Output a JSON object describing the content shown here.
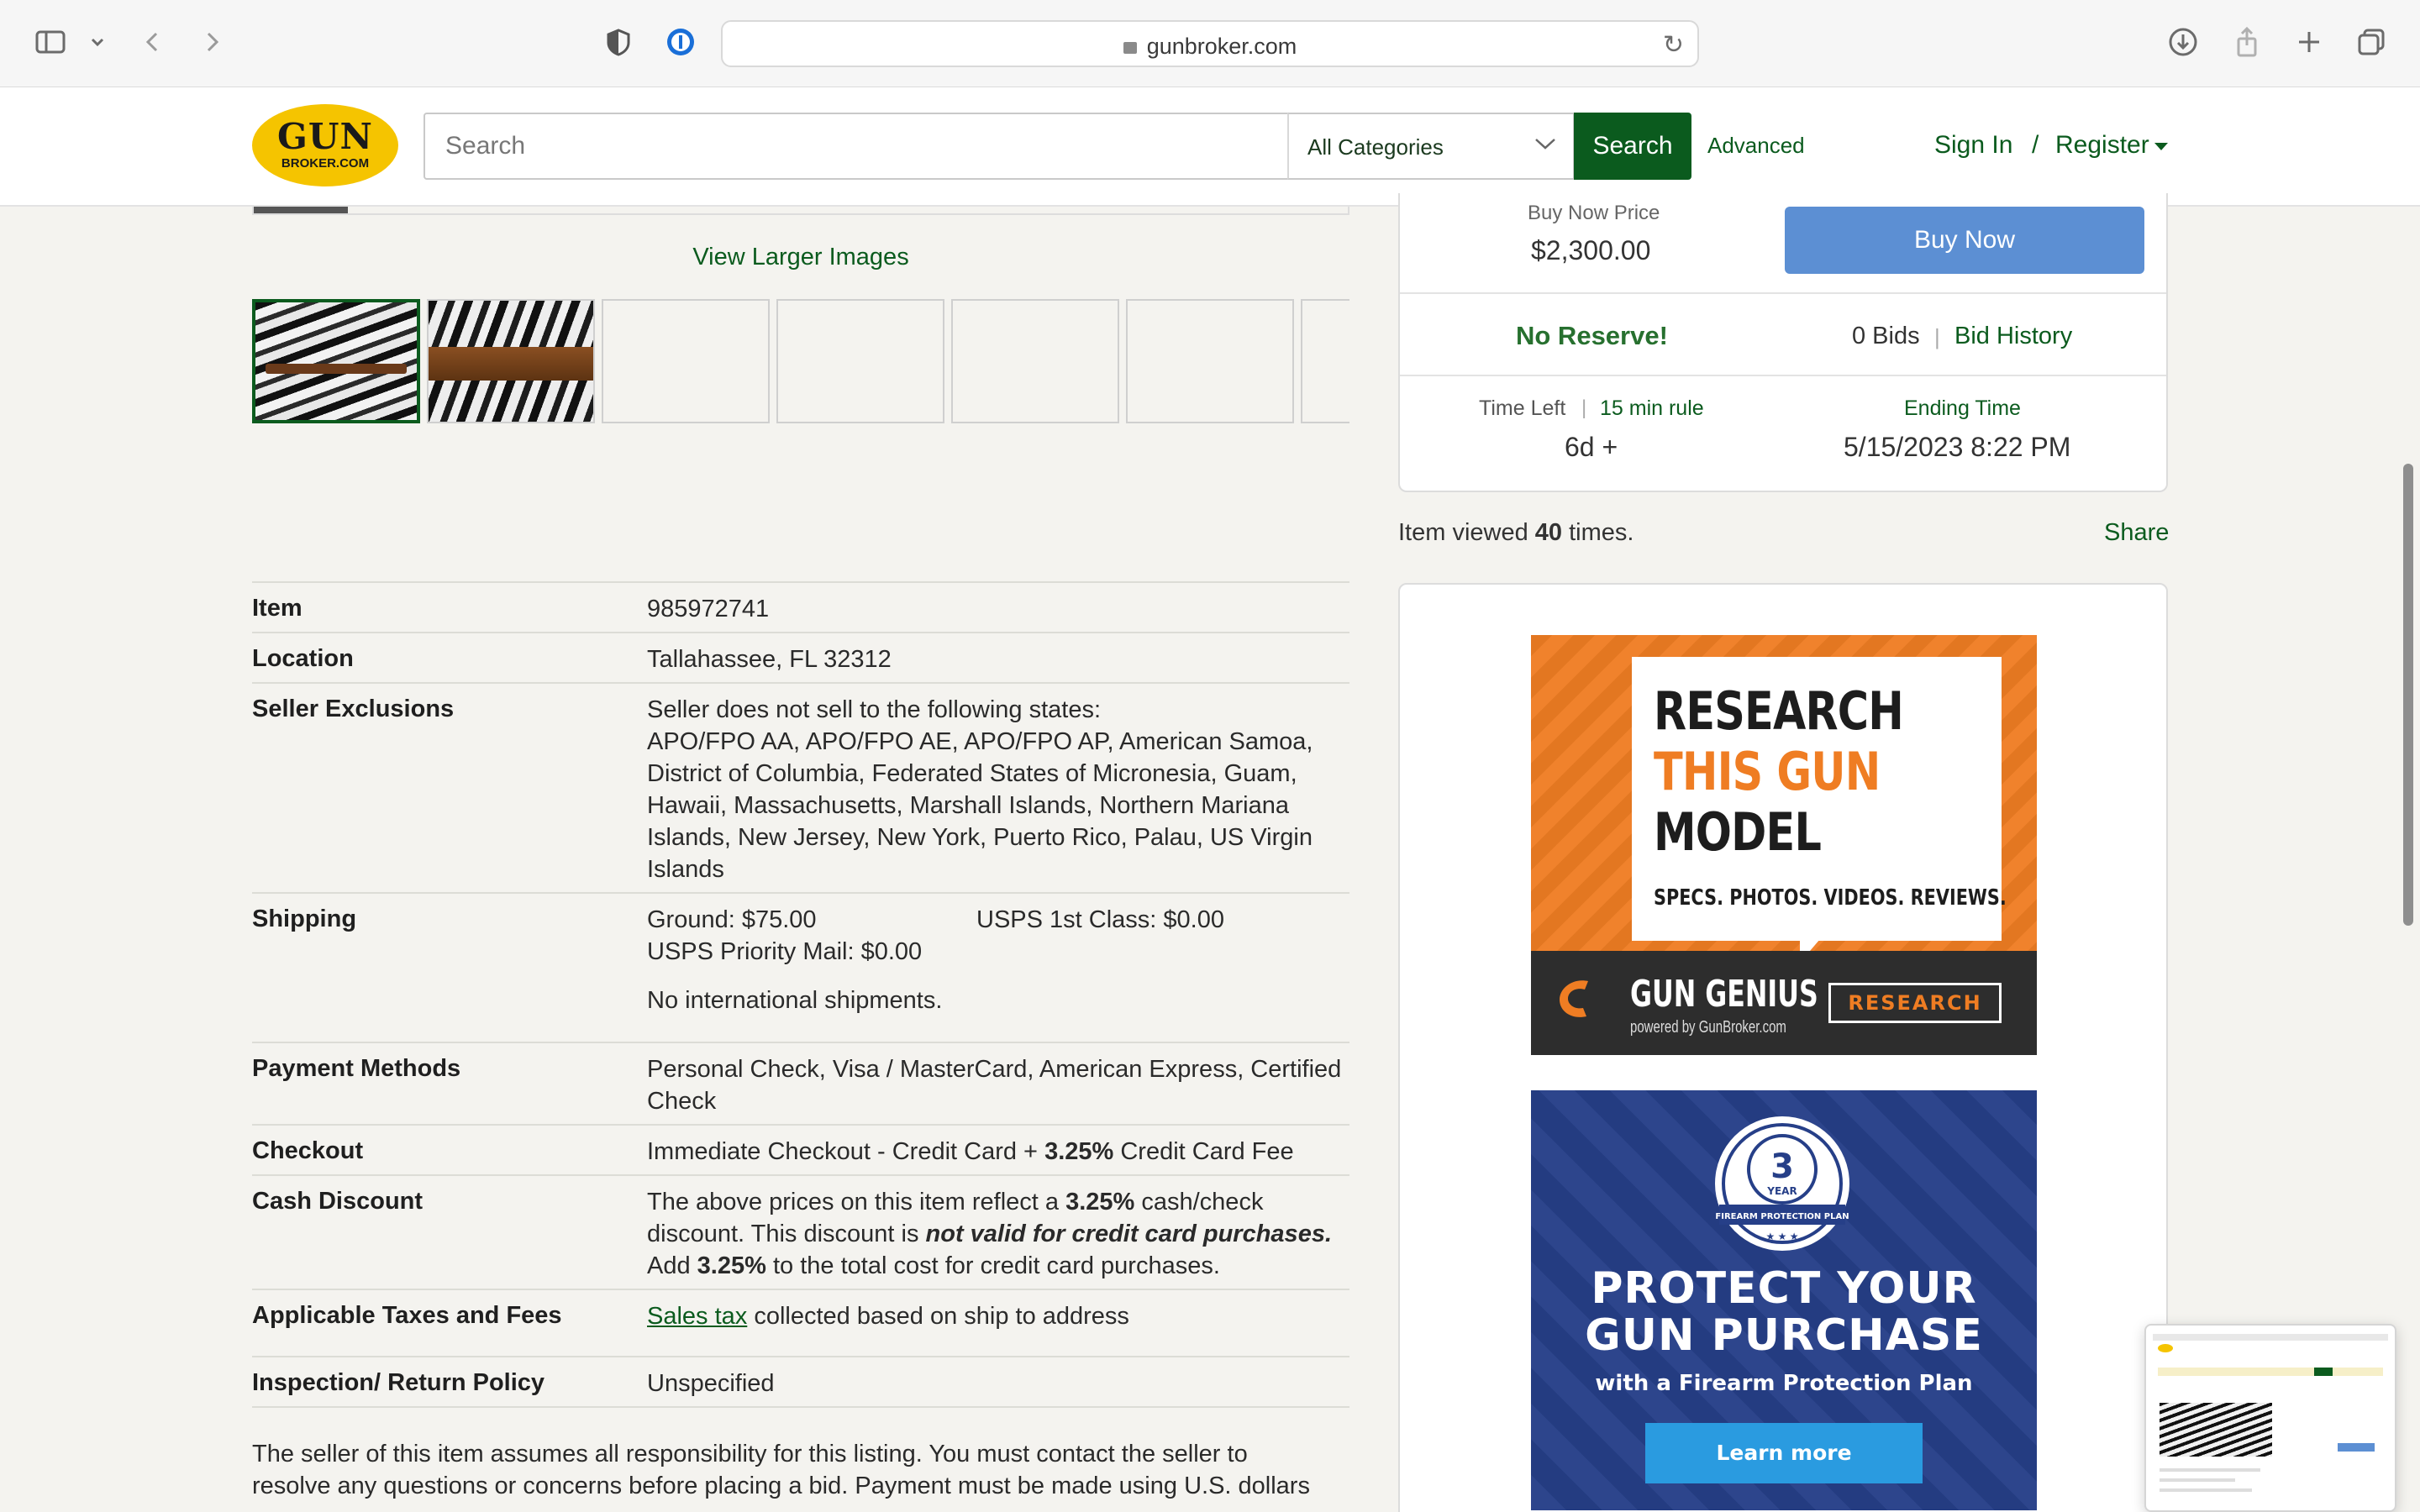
{
  "browser": {
    "url": "gunbroker.com"
  },
  "header": {
    "logo_line1": "GUN",
    "logo_line2": "BROKER.COM",
    "search_placeholder": "Search",
    "category_selected": "All Categories",
    "search_button": "Search",
    "advanced_link": "Advanced",
    "sign_in": "Sign In",
    "separator": "/",
    "register": "Register"
  },
  "gallery": {
    "view_larger": "View Larger Images"
  },
  "purchase": {
    "buy_now_label": "Buy Now Price",
    "buy_now_price": "$2,300.00",
    "buy_now_button": "Buy Now",
    "no_reserve": "No Reserve!",
    "bids": "0 Bids",
    "bid_history": "Bid History",
    "time_left_label": "Time Left",
    "rule_link": "15 min rule",
    "time_left_value": "6d +",
    "ending_time_label": "Ending Time",
    "ending_time_value": "5/15/2023 8:22 PM",
    "viewed_prefix": "Item viewed",
    "viewed_count": "40",
    "viewed_suffix": "times.",
    "share": "Share"
  },
  "details": {
    "item_label": "Item",
    "item_value": "985972741",
    "location_label": "Location",
    "location_value": "Tallahassee, FL 32312",
    "exclusions_label": "Seller Exclusions",
    "exclusions_line1": "Seller does not sell to the following states:",
    "exclusions_line2": "APO/FPO AA, APO/FPO AE, APO/FPO AP, American Samoa,",
    "exclusions_line3": "District of Columbia, Federated States of Micronesia, Guam,",
    "exclusions_line4": "Hawaii, Massachusetts, Marshall Islands, Northern Mariana",
    "exclusions_line5": "Islands, New Jersey, New York, Puerto Rico, Palau, US Virgin",
    "exclusions_line6": "Islands",
    "shipping_label": "Shipping",
    "ship_ground": "Ground: $75.00",
    "ship_usps_1st": "USPS 1st Class: $0.00",
    "ship_priority": "USPS Priority Mail: $0.00",
    "ship_intl": "No international shipments.",
    "payment_label": "Payment Methods",
    "payment_line1": "Personal Check, Visa / MasterCard, American Express, Certified",
    "payment_line2": "Check",
    "checkout_label": "Checkout",
    "checkout_pre": "Immediate Checkout - Credit Card + ",
    "checkout_pct": "3.25%",
    "checkout_post": " Credit Card Fee",
    "cash_label": "Cash Discount",
    "cash_l1_pre": "The above prices on this item reflect a ",
    "cash_pct": "3.25%",
    "cash_l1_post": " cash/check",
    "cash_l2_pre": "discount. This discount is ",
    "cash_l2_em": "not valid for credit card purchases.",
    "cash_l3_pre": "Add ",
    "cash_l3_post": " to the total cost for credit card purchases.",
    "taxes_label": "Applicable Taxes and Fees",
    "taxes_link": "Sales tax",
    "taxes_post": " collected based on ship to address",
    "return_label": "Inspection/ Return Policy",
    "return_value": "Unspecified"
  },
  "disclaimer": {
    "line1": "The seller of this item assumes all responsibility for this listing. You must contact the seller to",
    "line2": "resolve any questions or concerns before placing a bid. Payment must be made using U.S. dollars"
  },
  "ads": {
    "ad1_line1": "RESEARCH",
    "ad1_line2": "THIS GUN",
    "ad1_line3": "MODEL",
    "ad1_sub": "SPECS. PHOTOS. VIDEOS. REVIEWS.",
    "ad1_brand": "GUN GENIUS",
    "ad1_brand_sub": "powered by GunBroker.com",
    "ad1_button": "RESEARCH",
    "ad2_badge_num": "3",
    "ad2_badge_year": "YEAR",
    "ad2_badge_text": "FIREARM PROTECTION PLAN",
    "ad2_line1": "PROTECT YOUR",
    "ad2_line2": "GUN PURCHASE",
    "ad2_line3": "with a Firearm Protection Plan",
    "ad2_button": "Learn more"
  },
  "colors": {
    "brand_green": "#0b5b1e",
    "buy_now_blue": "#5c8fd3",
    "logo_yellow": "#f5c400",
    "ad_orange": "#ef7d23",
    "ad_blue": "#263f88"
  }
}
